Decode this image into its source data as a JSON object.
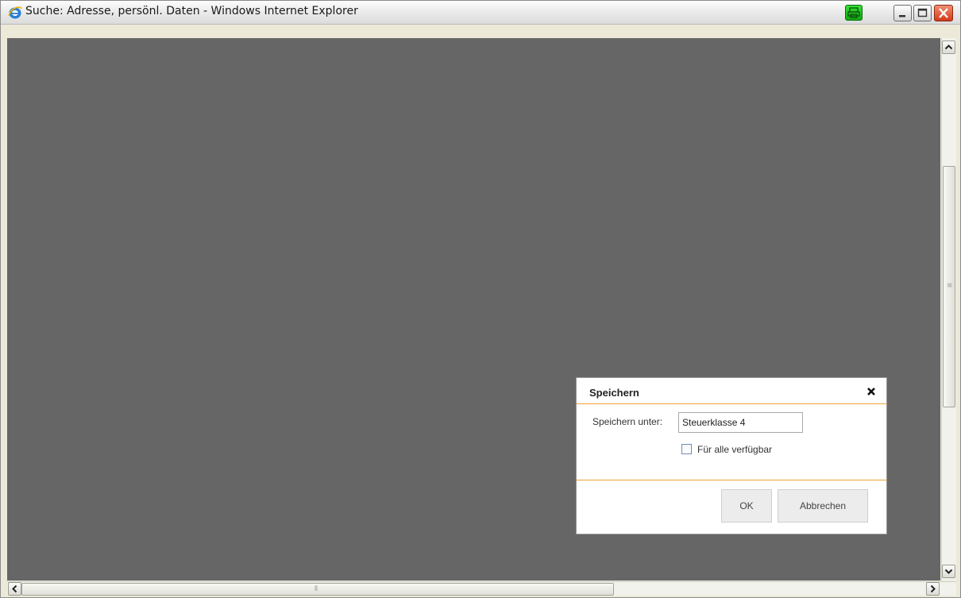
{
  "window": {
    "title": "Suche: Adresse, persönl. Daten - Windows Internet Explorer",
    "icons": {
      "app": "internet-explorer-icon",
      "tray": "printer-icon",
      "minimize": "minimize-icon",
      "maximize": "maximize-icon",
      "close": "close-icon"
    },
    "colors": {
      "content_background": "#666666",
      "accent_line": "#f0a030",
      "close_button": "#d33a1a",
      "tray_icon": "#22c022"
    }
  },
  "dialog": {
    "title": "Speichern",
    "close_icon": "close-x-icon",
    "save_as_label": "Speichern unter:",
    "save_as_value": "Steuerklasse 4",
    "available_all_label": "Für alle verfügbar",
    "available_all_checked": false,
    "ok_label": "OK",
    "cancel_label": "Abbrechen"
  }
}
